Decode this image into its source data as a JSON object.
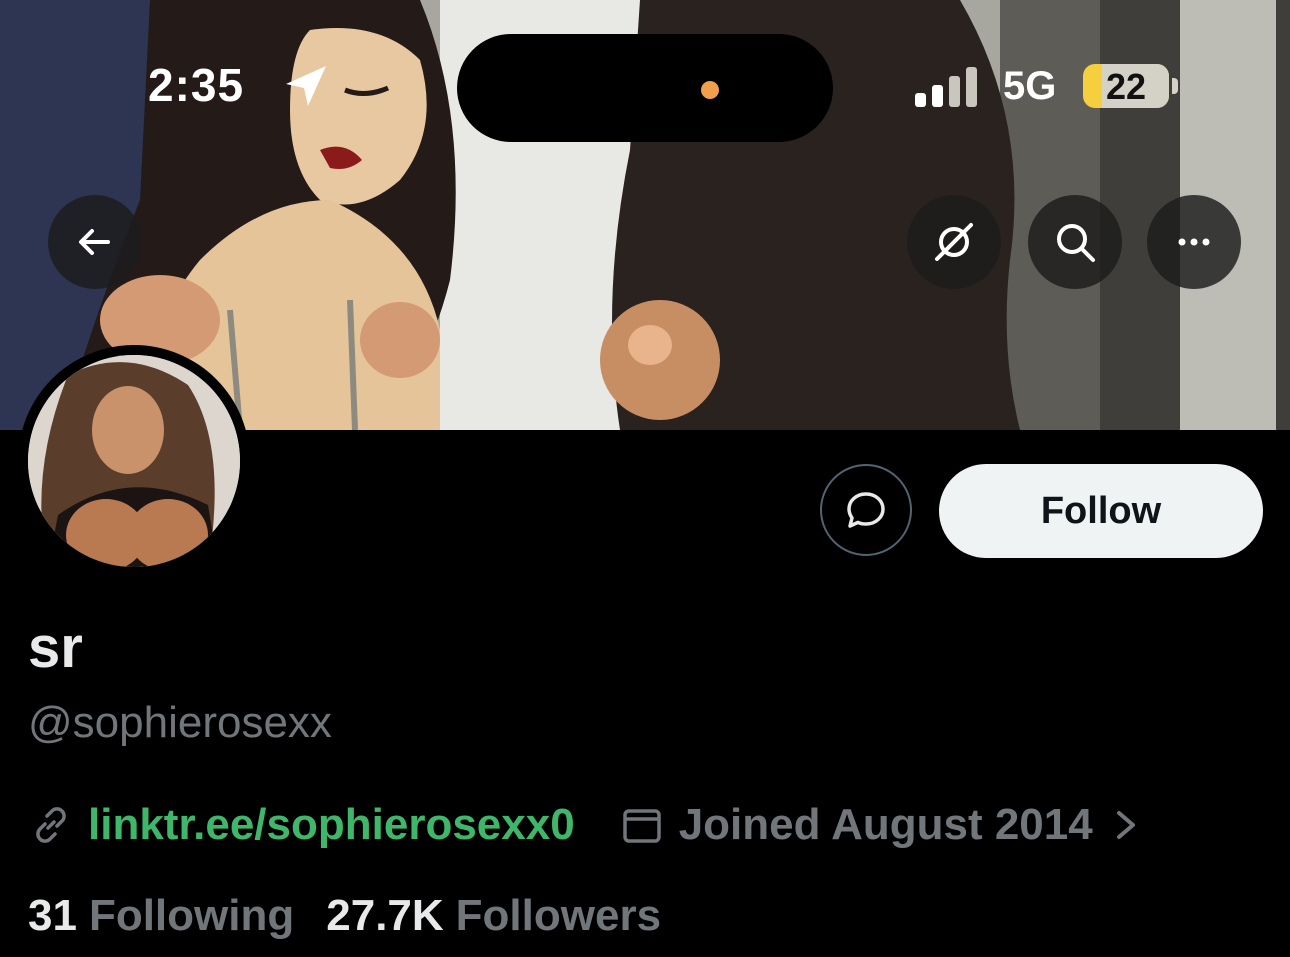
{
  "status_bar": {
    "time": "2:35",
    "network": "5G",
    "battery": "22"
  },
  "profile": {
    "display_name": "sr",
    "handle": "@sophierosexx",
    "link": "linktr.ee/sophierosexx0",
    "joined": "Joined August 2014",
    "following_count": "31",
    "following_label": "Following",
    "followers_count": "27.7K",
    "followers_label": "Followers"
  },
  "actions": {
    "follow_label": "Follow"
  },
  "icons": {
    "back": "arrow-left-icon",
    "grok": "grok-icon",
    "search": "search-icon",
    "more": "more-icon",
    "message": "message-icon",
    "link": "link-icon",
    "calendar": "calendar-icon",
    "location": "location-arrow-icon"
  },
  "colors": {
    "link": "#3fb76a",
    "muted": "#71767b",
    "follow_bg": "#eff3f4",
    "battery": "#f5cf3d"
  }
}
